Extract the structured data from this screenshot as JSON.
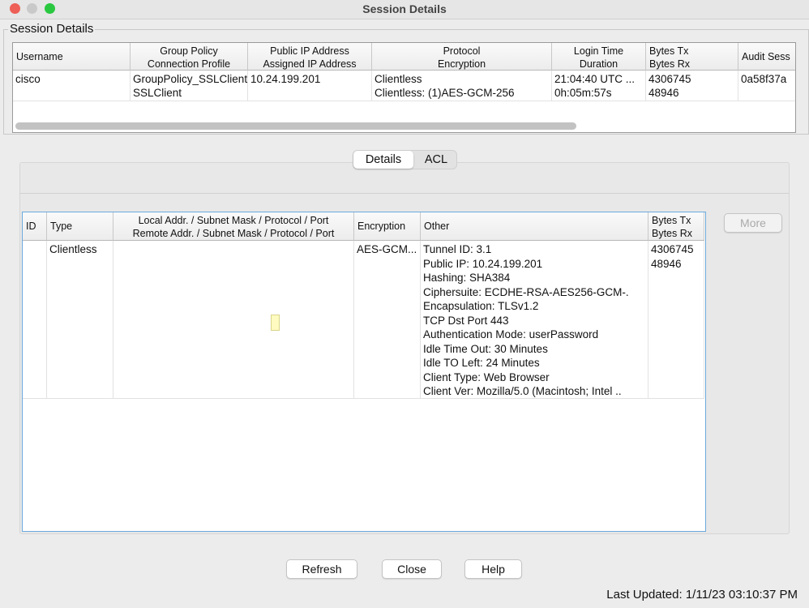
{
  "window": {
    "title": "Session Details"
  },
  "group_label": "Session Details",
  "session_table": {
    "headers": [
      [
        "Username",
        ""
      ],
      [
        "Group Policy",
        "Connection Profile"
      ],
      [
        "Public IP Address",
        "Assigned IP Address"
      ],
      [
        "Protocol",
        "Encryption"
      ],
      [
        "Login Time",
        "Duration"
      ],
      [
        "Bytes Tx",
        "Bytes Rx"
      ],
      [
        "Audit Sess",
        ""
      ]
    ],
    "row": [
      [
        "cisco",
        ""
      ],
      [
        "GroupPolicy_SSLClient",
        "SSLClient"
      ],
      [
        "10.24.199.201",
        ""
      ],
      [
        "Clientless",
        "Clientless: (1)AES-GCM-256"
      ],
      [
        "21:04:40 UTC ...",
        "0h:05m:57s"
      ],
      [
        "4306745",
        "48946"
      ],
      [
        "0a58f37a",
        ""
      ]
    ]
  },
  "tabs": [
    {
      "label": "Details",
      "selected": true
    },
    {
      "label": "ACL",
      "selected": false
    }
  ],
  "details_table": {
    "headers": [
      [
        "ID",
        ""
      ],
      [
        "Type",
        ""
      ],
      [
        "Local Addr. / Subnet Mask / Protocol / Port",
        "Remote Addr. / Subnet Mask / Protocol / Port"
      ],
      [
        "Encryption",
        ""
      ],
      [
        "Other",
        ""
      ],
      [
        "Bytes Tx",
        "Bytes Rx"
      ]
    ],
    "row": {
      "id": "",
      "type": "Clientless",
      "addr": "",
      "encryption": "AES-GCM...",
      "other": [
        "Tunnel ID: 3.1",
        "Public IP: 10.24.199.201",
        "Hashing: SHA384",
        "Ciphersuite: ECDHE-RSA-AES256-GCM-.",
        "Encapsulation: TLSv1.2",
        "TCP Dst Port 443",
        "Authentication Mode: userPassword",
        "Idle Time Out: 30 Minutes",
        "Idle TO Left: 24 Minutes",
        "Client Type: Web Browser",
        "Client Ver: Mozilla/5.0 (Macintosh; Intel .."
      ],
      "bytes": [
        "4306745",
        "48946"
      ]
    }
  },
  "buttons": {
    "more": "More",
    "refresh": "Refresh",
    "close": "Close",
    "help": "Help"
  },
  "status": "Last Updated: 1/11/23 03:10:37 PM"
}
